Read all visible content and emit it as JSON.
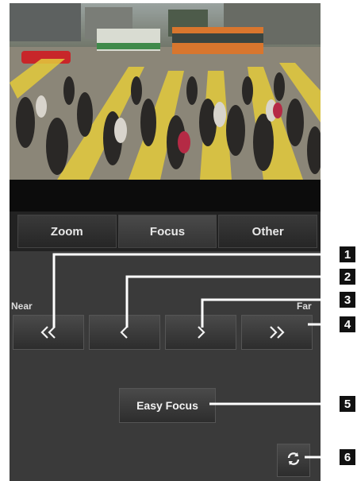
{
  "tabs": [
    {
      "label": "Zoom"
    },
    {
      "label": "Focus"
    },
    {
      "label": "Other"
    }
  ],
  "active_tab": "Focus",
  "focus": {
    "near_label": "Near",
    "far_label": "Far",
    "easy_focus_label": "Easy Focus"
  },
  "callouts": [
    "1",
    "2",
    "3",
    "4",
    "5",
    "6"
  ],
  "colors": {
    "panel": "#3a3a3a",
    "button": "#3a3a3a",
    "text": "#f2f2f2",
    "callout_badge": "#111111"
  }
}
